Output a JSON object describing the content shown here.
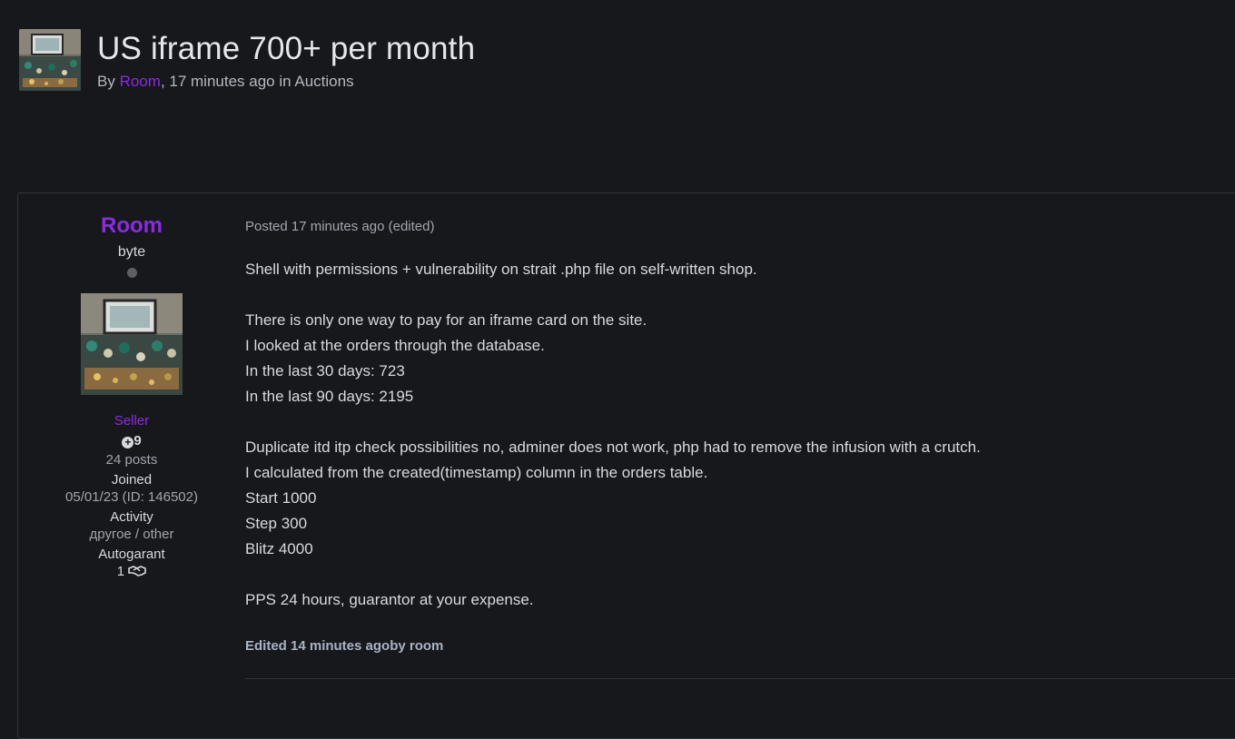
{
  "topic": {
    "title": "US iframe 700+ per month",
    "by_prefix": "By",
    "author": "Room",
    "time": ", 17 minutes ago in",
    "forum": "Auctions"
  },
  "author_panel": {
    "name": "Room",
    "rank": "byte",
    "group": "Seller",
    "reputation": "9",
    "posts": "24 posts",
    "joined_label": "Joined",
    "joined_value": "05/01/23 (ID: 146502)",
    "activity_label": "Activity",
    "activity_value": "другое / other",
    "autogarant_label": "Autogarant",
    "autogarant_value": "1",
    "online_status_icon": "status-dot-icon",
    "autogarant_icon": "handshake-icon",
    "colors": {
      "username": "#8a2be2",
      "background": "#17181c"
    }
  },
  "post": {
    "posted": "Posted 17 minutes ago (edited)",
    "lines": [
      "Shell with permissions + vulnerability on strait .php file on self-written shop.",
      "",
      "There is only one way to pay for an iframe card on the site.",
      "I looked at the orders through the database.",
      "In the last 30 days: 723",
      "In the last 90 days: 2195",
      "",
      "Duplicate itd itp check possibilities no, adminer does not work, php had to remove the infusion with a crutch.",
      "I calculated from the created(timestamp) column in the orders table.",
      "Start 1000",
      "Step 300",
      "Blitz 4000",
      "",
      "PPS 24 hours, guarantor at your expense."
    ],
    "edited": "Edited 14 minutes agoby room"
  }
}
